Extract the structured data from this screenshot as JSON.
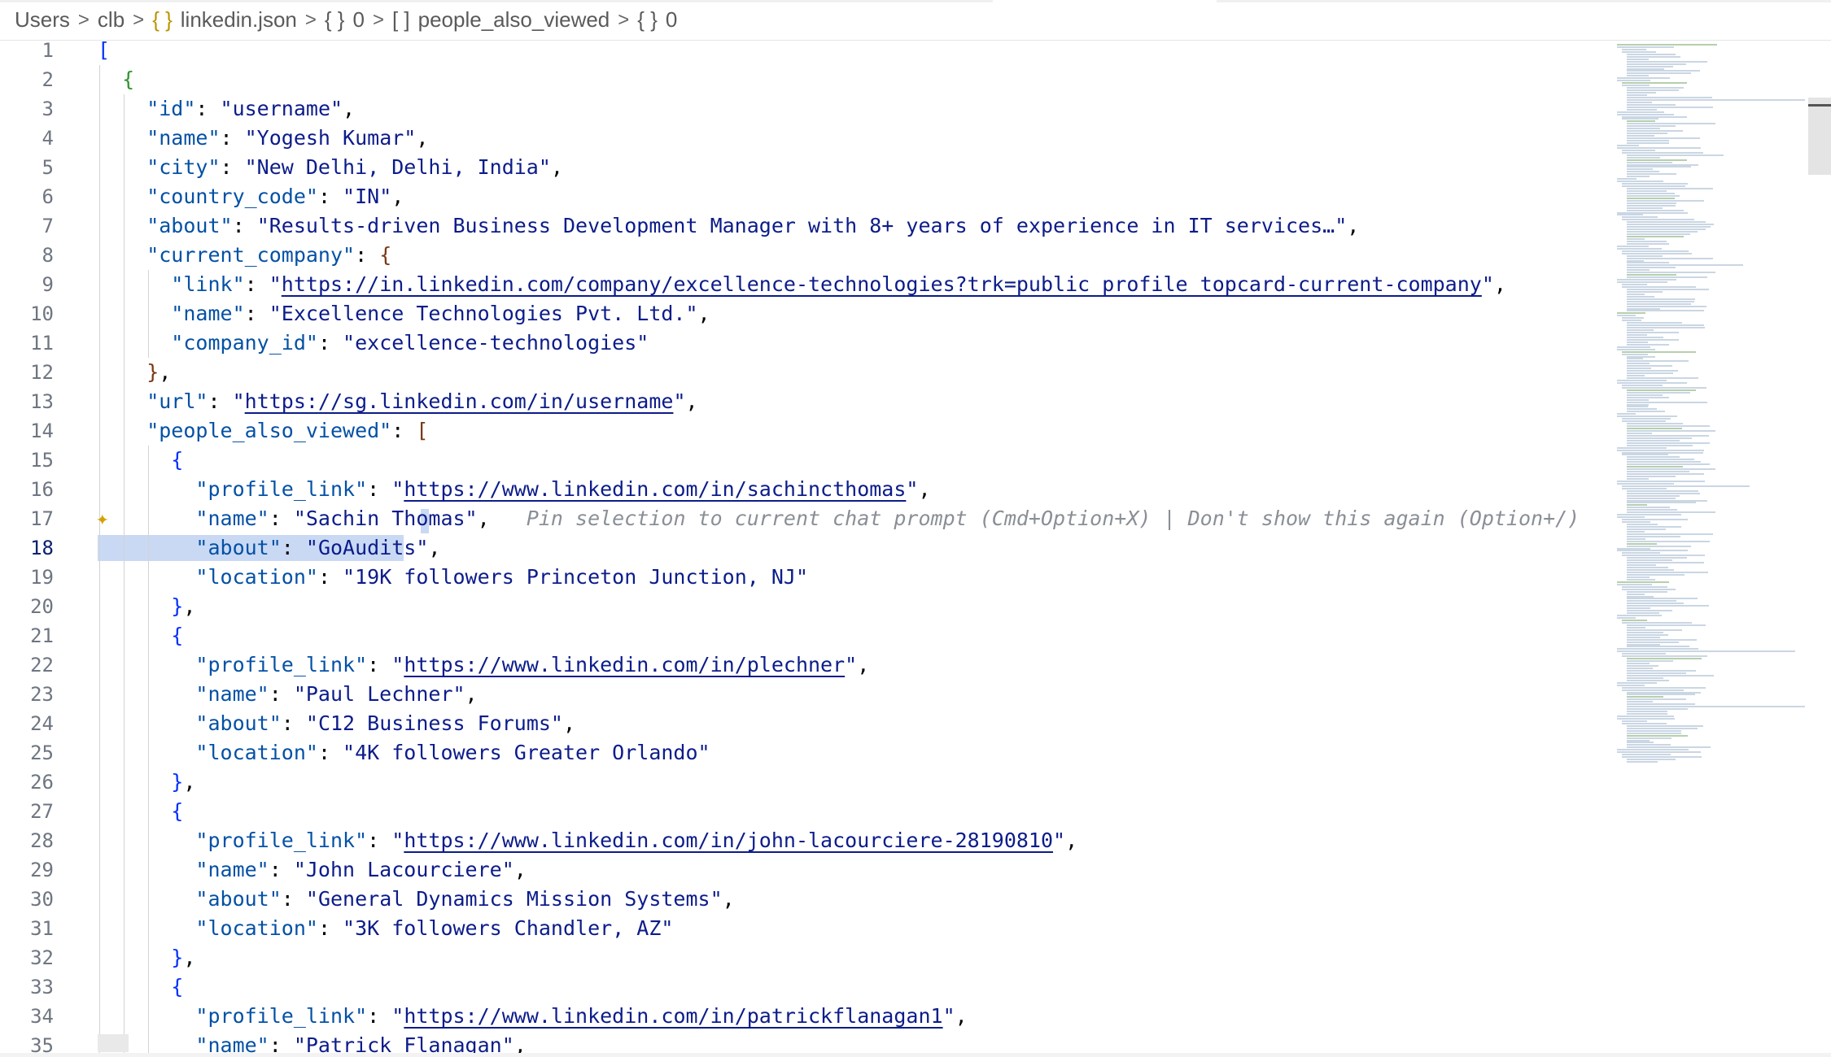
{
  "breadcrumb": {
    "items": [
      "Users",
      "clb",
      "linkedin.json",
      "0",
      "people_also_viewed",
      "0"
    ],
    "icons": [
      "",
      "",
      "{}",
      "{}",
      "[]",
      "{}"
    ]
  },
  "editor": {
    "active_line": 18,
    "inline_hint": "Pin selection to current chat prompt (Cmd+Option+X) | Don't show this again (Option+/)",
    "lines": [
      [
        [
          "b1",
          "["
        ]
      ],
      [
        [
          "b2",
          "  {"
        ]
      ],
      [
        [
          "k",
          "    \"id\""
        ],
        [
          "p",
          ": "
        ],
        [
          "s",
          "\"username\""
        ],
        [
          "p",
          ","
        ]
      ],
      [
        [
          "k",
          "    \"name\""
        ],
        [
          "p",
          ": "
        ],
        [
          "s",
          "\"Yogesh Kumar\""
        ],
        [
          "p",
          ","
        ]
      ],
      [
        [
          "k",
          "    \"city\""
        ],
        [
          "p",
          ": "
        ],
        [
          "s",
          "\"New Delhi, Delhi, India\""
        ],
        [
          "p",
          ","
        ]
      ],
      [
        [
          "k",
          "    \"country_code\""
        ],
        [
          "p",
          ": "
        ],
        [
          "s",
          "\"IN\""
        ],
        [
          "p",
          ","
        ]
      ],
      [
        [
          "k",
          "    \"about\""
        ],
        [
          "p",
          ": "
        ],
        [
          "s",
          "\"Results-driven Business Development Manager with 8+ years of experience in IT services…\""
        ],
        [
          "p",
          ","
        ]
      ],
      [
        [
          "k",
          "    \"current_company\""
        ],
        [
          "p",
          ": "
        ],
        [
          "b3",
          "{"
        ]
      ],
      [
        [
          "k",
          "      \"link\""
        ],
        [
          "p",
          ": "
        ],
        [
          "s",
          "\""
        ],
        [
          "u",
          "https://in.linkedin.com/company/excellence-technologies?trk=public_profile_topcard-current-company"
        ],
        [
          "s",
          "\""
        ],
        [
          "p",
          ","
        ]
      ],
      [
        [
          "k",
          "      \"name\""
        ],
        [
          "p",
          ": "
        ],
        [
          "s",
          "\"Excellence Technologies Pvt. Ltd.\""
        ],
        [
          "p",
          ","
        ]
      ],
      [
        [
          "k",
          "      \"company_id\""
        ],
        [
          "p",
          ": "
        ],
        [
          "s",
          "\"excellence-technologies\""
        ]
      ],
      [
        [
          "b3",
          "    }"
        ],
        [
          "p",
          ","
        ]
      ],
      [
        [
          "k",
          "    \"url\""
        ],
        [
          "p",
          ": "
        ],
        [
          "s",
          "\""
        ],
        [
          "u",
          "https://sg.linkedin.com/in/username"
        ],
        [
          "s",
          "\""
        ],
        [
          "p",
          ","
        ]
      ],
      [
        [
          "k",
          "    \"people_also_viewed\""
        ],
        [
          "p",
          ": "
        ],
        [
          "b3",
          "["
        ]
      ],
      [
        [
          "b1",
          "      {"
        ]
      ],
      [
        [
          "k",
          "        \"profile_link\""
        ],
        [
          "p",
          ": "
        ],
        [
          "s",
          "\""
        ],
        [
          "u",
          "https://www.linkedin.com/in/sachincthomas"
        ],
        [
          "s",
          "\""
        ],
        [
          "p",
          ","
        ]
      ],
      [
        [
          "k",
          "        \"name\""
        ],
        [
          "p",
          ": "
        ],
        [
          "s",
          "\"Sachin Thomas\""
        ],
        [
          "p",
          ","
        ],
        [
          "p",
          "   "
        ],
        [
          "hint",
          "HINT"
        ]
      ],
      [
        [
          "k",
          "        \"about\""
        ],
        [
          "p",
          ": "
        ],
        [
          "s",
          "\"GoAudits\""
        ],
        [
          "p",
          ","
        ]
      ],
      [
        [
          "k",
          "        \"location\""
        ],
        [
          "p",
          ": "
        ],
        [
          "s",
          "\"19K followers Princeton Junction, NJ\""
        ]
      ],
      [
        [
          "b1",
          "      }"
        ],
        [
          "p",
          ","
        ]
      ],
      [
        [
          "b1",
          "      {"
        ]
      ],
      [
        [
          "k",
          "        \"profile_link\""
        ],
        [
          "p",
          ": "
        ],
        [
          "s",
          "\""
        ],
        [
          "u",
          "https://www.linkedin.com/in/plechner"
        ],
        [
          "s",
          "\""
        ],
        [
          "p",
          ","
        ]
      ],
      [
        [
          "k",
          "        \"name\""
        ],
        [
          "p",
          ": "
        ],
        [
          "s",
          "\"Paul Lechner\""
        ],
        [
          "p",
          ","
        ]
      ],
      [
        [
          "k",
          "        \"about\""
        ],
        [
          "p",
          ": "
        ],
        [
          "s",
          "\"C12 Business Forums\""
        ],
        [
          "p",
          ","
        ]
      ],
      [
        [
          "k",
          "        \"location\""
        ],
        [
          "p",
          ": "
        ],
        [
          "s",
          "\"4K followers Greater Orlando\""
        ]
      ],
      [
        [
          "b1",
          "      }"
        ],
        [
          "p",
          ","
        ]
      ],
      [
        [
          "b1",
          "      {"
        ]
      ],
      [
        [
          "k",
          "        \"profile_link\""
        ],
        [
          "p",
          ": "
        ],
        [
          "s",
          "\""
        ],
        [
          "u",
          "https://www.linkedin.com/in/john-lacourciere-28190810"
        ],
        [
          "s",
          "\""
        ],
        [
          "p",
          ","
        ]
      ],
      [
        [
          "k",
          "        \"name\""
        ],
        [
          "p",
          ": "
        ],
        [
          "s",
          "\"John Lacourciere\""
        ],
        [
          "p",
          ","
        ]
      ],
      [
        [
          "k",
          "        \"about\""
        ],
        [
          "p",
          ": "
        ],
        [
          "s",
          "\"General Dynamics Mission Systems\""
        ],
        [
          "p",
          ","
        ]
      ],
      [
        [
          "k",
          "        \"location\""
        ],
        [
          "p",
          ": "
        ],
        [
          "s",
          "\"3K followers Chandler, AZ\""
        ]
      ],
      [
        [
          "b1",
          "      }"
        ],
        [
          "p",
          ","
        ]
      ],
      [
        [
          "b1",
          "      {"
        ]
      ],
      [
        [
          "k",
          "        \"profile_link\""
        ],
        [
          "p",
          ": "
        ],
        [
          "s",
          "\""
        ],
        [
          "u",
          "https://www.linkedin.com/in/patrickflanagan1"
        ],
        [
          "s",
          "\""
        ],
        [
          "p",
          ","
        ]
      ],
      [
        [
          "k",
          "        \"name\""
        ],
        [
          "p",
          ": "
        ],
        [
          "s",
          "\"Patrick Flanagan\""
        ],
        [
          "p",
          ","
        ]
      ]
    ]
  }
}
